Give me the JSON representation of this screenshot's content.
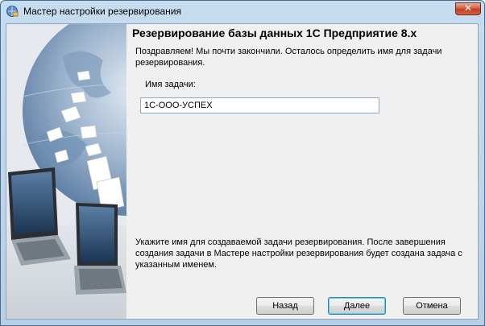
{
  "window": {
    "title": "Мастер настройки резервирования",
    "close_glyph": "✕"
  },
  "page": {
    "heading": "Резервирование базы данных 1С Предприятие 8.x",
    "intro": "Поздравляем! Мы почти закончили. Осталось определить имя для задачи резервирования.",
    "field_label": "Имя задачи:",
    "field_value": "1С-ООО-УСПЕХ",
    "hint": "Укажите имя для создаваемой задачи резервирования. После завершения создания задачи в Мастере настройки резервирования будет создана задача с указанным именем."
  },
  "buttons": {
    "back": "Назад",
    "next": "Далее",
    "cancel": "Отмена"
  },
  "colors": {
    "window_frame": "#b7cfe6",
    "close_button": "#c43b1e",
    "dialog_background": "#f0f0f0",
    "default_button_border": "#3c7fb1"
  },
  "icons": {
    "app": "backup-wizard-icon",
    "side_image": "globe-laptops-illustration"
  }
}
